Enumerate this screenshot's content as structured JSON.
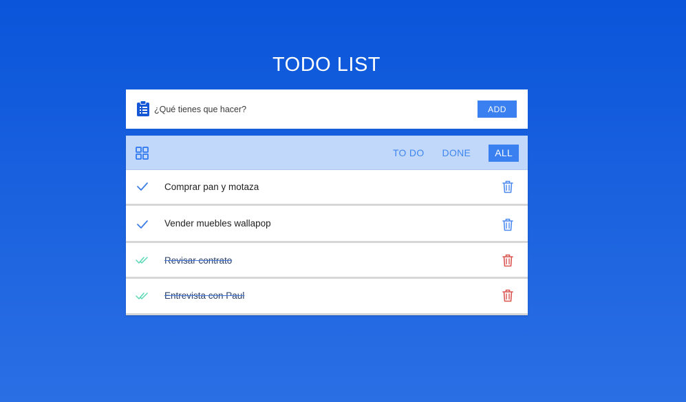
{
  "app": {
    "title": "TODO LIST"
  },
  "add_bar": {
    "placeholder": "¿Qué tienes que hacer?",
    "value": "",
    "add_label": "ADD",
    "icon": "clipboard-list-icon"
  },
  "filters": {
    "icon": "grid-icon",
    "items": [
      {
        "label": "TO DO",
        "active": false
      },
      {
        "label": "DONE",
        "active": false
      },
      {
        "label": "ALL",
        "active": true
      }
    ]
  },
  "todos": [
    {
      "text": "Comprar pan y motaza",
      "done": false,
      "check_icon": "check-icon",
      "delete_icon": "trash-icon"
    },
    {
      "text": "Vender muebles wallapop",
      "done": false,
      "check_icon": "check-icon",
      "delete_icon": "trash-icon"
    },
    {
      "text": "Revisar contrato",
      "done": true,
      "check_icon": "double-check-icon",
      "delete_icon": "trash-icon"
    },
    {
      "text": "Entrevista con Paul",
      "done": true,
      "check_icon": "double-check-icon",
      "delete_icon": "trash-icon"
    }
  ],
  "colors": {
    "background_top": "#0a55da",
    "background_bottom": "#2b6fe4",
    "accent": "#3b80f0",
    "filter_bar": "#c2d8fb",
    "check_pending": "#3b7de6",
    "check_done": "#57d7b4",
    "trash_pending": "#4a8af0",
    "trash_done": "#d9534f"
  }
}
